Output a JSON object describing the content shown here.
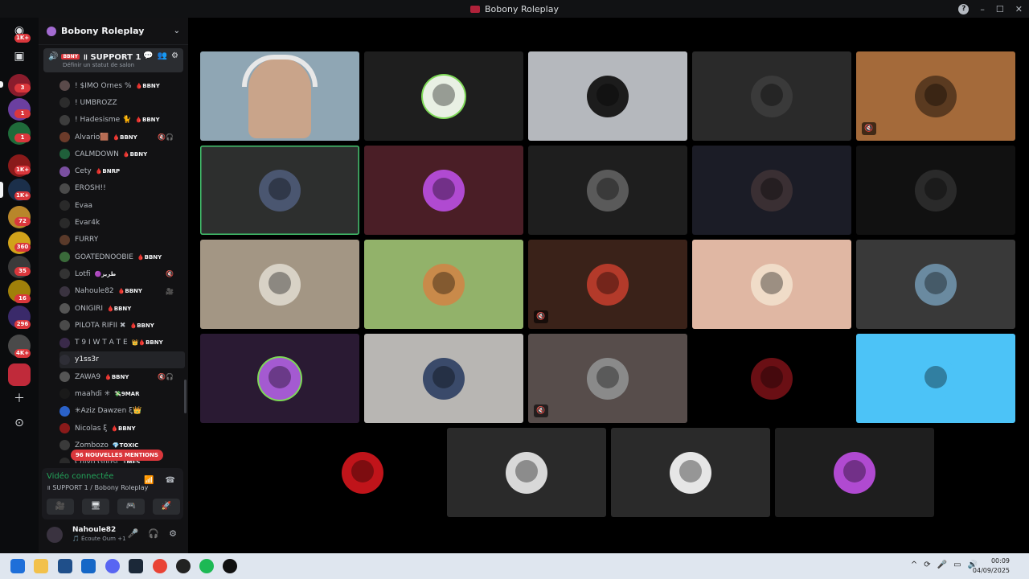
{
  "window": {
    "title": "Bobony Roleplay",
    "help_icon": "help-icon",
    "controls": [
      "–",
      "☐",
      "✕"
    ]
  },
  "rail": {
    "badges": [
      "1K+",
      "3",
      "1",
      "1",
      "1K+",
      "1K+",
      "72",
      "360",
      "35",
      "16",
      "296",
      "4K+"
    ]
  },
  "server": {
    "name": "Bobony Roleplay",
    "voice_channel": {
      "tag": "BBNY",
      "name": "॥ SUPPORT 1",
      "status_placeholder": "Définir un statut de salon"
    }
  },
  "members": [
    {
      "name": "! $IMO Ornes %",
      "tag": "🩸BBNY",
      "color": "#5a4a4a"
    },
    {
      "name": "! UMBROZZ",
      "tag": "",
      "color": "#2c2c2c"
    },
    {
      "name": "! Hadesisme 🐈",
      "tag": "🩸BBNY",
      "color": "#3d3d3d"
    },
    {
      "name": "Alvario🟫",
      "tag": "🩸BBNY",
      "color": "#6b3b2a",
      "mic": "🔇🎧"
    },
    {
      "name": "CALMDOWN",
      "tag": "🩸BBNY",
      "color": "#1f5f3a"
    },
    {
      "name": "Cety",
      "tag": "🩸BNRP",
      "color": "#7a4fa0"
    },
    {
      "name": "EROSH!!",
      "tag": "",
      "color": "#4a4a4a"
    },
    {
      "name": "Evaa",
      "tag": "",
      "color": "#2a2a2a"
    },
    {
      "name": "Evar4k",
      "tag": "",
      "color": "#2a2a2a"
    },
    {
      "name": "FURRY",
      "tag": "",
      "color": "#5a3a2a"
    },
    {
      "name": "GOATEDNOOBIE",
      "tag": "🩸BBNY",
      "color": "#3a6a3a"
    },
    {
      "name": "Lotfi",
      "tag": "🟣طريز",
      "color": "#333333",
      "mic": "🔇"
    },
    {
      "name": "Nahoule82",
      "tag": "🩸BBNY",
      "color": "#3a3340",
      "mic": "🎥"
    },
    {
      "name": "ONIGIRI",
      "tag": "🩸BBNY",
      "color": "#555555"
    },
    {
      "name": "PILOTA RIFII ✖",
      "tag": "🩸BBNY",
      "color": "#4a4a4a"
    },
    {
      "name": "T 9 I W T A T E",
      "tag": "👑🩸BBNY",
      "color": "#3a2a4a"
    },
    {
      "name": "y1ss3r",
      "tag": "",
      "color": "#2e2e36",
      "hover": true
    },
    {
      "name": "ZAWA9",
      "tag": "🩸BBNY",
      "color": "#555555",
      "mic": "🔇🎧"
    },
    {
      "name": "maahdi ✳",
      "tag": "💸9MAR",
      "color": "#1a1a1a"
    },
    {
      "name": "✳Aziz Dawzen ξ👑",
      "tag": "",
      "color": "#2b62c9"
    },
    {
      "name": "Nicolas ξ",
      "tag": "🩸BBNY",
      "color": "#8a1a1a"
    },
    {
      "name": "Zombozo",
      "tag": "💎TOXIC",
      "color": "#3a3a3a"
    },
    {
      "name": "Chiyo Ghost",
      "tag": "⚡MES",
      "color": "#2a2a2a"
    }
  ],
  "mentions_pill": "96 NOUVELLES MENTIONS",
  "voice_panel": {
    "status": "Vidéo connectée",
    "channel": "॥ SUPPORT 1 / Bobony Roleplay",
    "buttons": [
      "🎥",
      "🖥",
      "🎮",
      "🚀"
    ]
  },
  "user": {
    "name": "Nahoule82",
    "activity": "🎵 Écoute Oum +1"
  },
  "tiles": [
    {
      "bg": "#8fa6b4",
      "ava": "#c9a48a",
      "cam": true
    },
    {
      "bg": "#1e1e1e",
      "ava": "#e9f0e4",
      "ring": "#7ed957"
    },
    {
      "bg": "#b5b8bd",
      "ava": "#1c1c1c"
    },
    {
      "bg": "#2a2a2a",
      "ava": "#3a3a3a"
    },
    {
      "bg": "#a46a3a",
      "ava": "#5a3a20",
      "icon": "🔇"
    },
    {
      "bg": "#2d2f2e",
      "ava": "#4a5670",
      "speaking": true
    },
    {
      "bg": "#4a1e26",
      "ava": "#b04ad1"
    },
    {
      "bg": "#1e1e1e",
      "ava": "#5a5a5a"
    },
    {
      "bg": "#1b1c26",
      "ava": "#3a2f33"
    },
    {
      "bg": "#111111",
      "ava": "#2a2a2a"
    },
    {
      "bg": "#a39684",
      "ava": "#d8d2c6"
    },
    {
      "bg": "#92b26a",
      "ava": "#c98a4a"
    },
    {
      "bg": "#3a2219",
      "ava": "#b33a2a",
      "icon": "🔇"
    },
    {
      "bg": "#e0b7a3",
      "ava": "#f0dcc8"
    },
    {
      "bg": "#393939",
      "ava": "#6a8aa0"
    },
    {
      "bg": "#2a1a33",
      "ava": "#a45ad1",
      "ring": "#7ed957"
    },
    {
      "bg": "#b8b6b3",
      "ava": "#3a4a6a"
    },
    {
      "bg": "#574d4b",
      "ava": "#8a8a8a",
      "icon": "🔇"
    },
    {
      "bg": "#000000",
      "ava": "#6a0f14"
    },
    {
      "bg": "#4cc3f7",
      "ava": "#4cc3f7"
    },
    {
      "bg": "#000000",
      "ava": "#c0141a"
    },
    {
      "bg": "#2a2a2a",
      "ava": "#d8d8d8"
    },
    {
      "bg": "#2a2a2a",
      "ava": "#e6e6e6"
    },
    {
      "bg": "#1e1e1e",
      "ava": "#b04ad1"
    }
  ],
  "taskbar": {
    "time": "00:09",
    "date": "04/09/2025",
    "tray": [
      "^",
      "⟳",
      "🎤",
      "▭",
      "🔊"
    ]
  }
}
